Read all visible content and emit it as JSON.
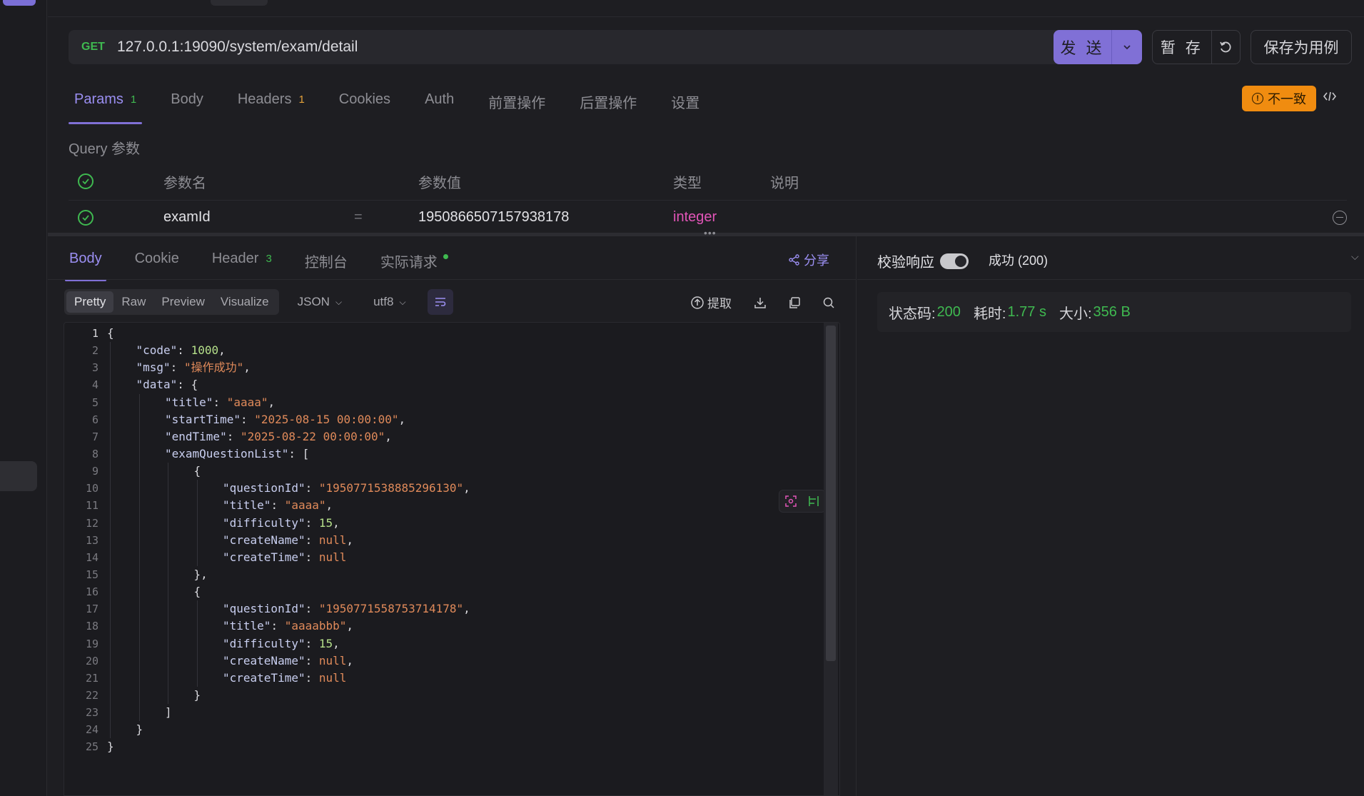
{
  "request": {
    "method": "GET",
    "url": "127.0.0.1:19090/system/exam/detail",
    "send_label": "发 送",
    "stash_label": "暂 存",
    "save_case_label": "保存为用例"
  },
  "req_tabs": [
    {
      "label": "Params",
      "badge": "1"
    },
    {
      "label": "Body",
      "badge": ""
    },
    {
      "label": "Headers",
      "badge": "1"
    },
    {
      "label": "Cookies",
      "badge": ""
    },
    {
      "label": "Auth",
      "badge": ""
    },
    {
      "label": "前置操作",
      "badge": ""
    },
    {
      "label": "后置操作",
      "badge": ""
    },
    {
      "label": "设置",
      "badge": ""
    }
  ],
  "mismatch_label": "不一致",
  "query": {
    "title": "Query 参数",
    "headers": {
      "name": "参数名",
      "value": "参数值",
      "type": "类型",
      "desc": "说明"
    },
    "row": {
      "name": "examId",
      "eq": "=",
      "value": "1950866507157938178",
      "type": "integer",
      "desc": ""
    }
  },
  "resp_tabs": [
    {
      "label": "Body",
      "badge": ""
    },
    {
      "label": "Cookie",
      "badge": ""
    },
    {
      "label": "Header",
      "badge": "3"
    },
    {
      "label": "控制台",
      "badge": ""
    },
    {
      "label": "实际请求",
      "badge": ""
    }
  ],
  "share_label": "分享",
  "format_buttons": [
    "Pretty",
    "Raw",
    "Preview",
    "Visualize"
  ],
  "format_select": "JSON",
  "encoding_select": "utf8",
  "extract_label": "提取",
  "validate_label": "校验响应",
  "success_label": "成功 (200)",
  "status": {
    "code_label": "状态码:",
    "code": "200",
    "time_label": "耗时:",
    "time": "1.77 s",
    "size_label": "大小:",
    "size": "356 B"
  },
  "code_lines": [
    [
      {
        "t": "p",
        "v": "{"
      }
    ],
    [
      {
        "t": "k",
        "v": "\"code\""
      },
      {
        "t": "p",
        "v": ": "
      },
      {
        "t": "n",
        "v": "1000"
      },
      {
        "t": "p",
        "v": ","
      }
    ],
    [
      {
        "t": "k",
        "v": "\"msg\""
      },
      {
        "t": "p",
        "v": ": "
      },
      {
        "t": "s",
        "v": "\"操作成功\""
      },
      {
        "t": "p",
        "v": ","
      }
    ],
    [
      {
        "t": "k",
        "v": "\"data\""
      },
      {
        "t": "p",
        "v": ": {"
      }
    ],
    [
      {
        "t": "k",
        "v": "\"title\""
      },
      {
        "t": "p",
        "v": ": "
      },
      {
        "t": "s",
        "v": "\"aaaa\""
      },
      {
        "t": "p",
        "v": ","
      }
    ],
    [
      {
        "t": "k",
        "v": "\"startTime\""
      },
      {
        "t": "p",
        "v": ": "
      },
      {
        "t": "s",
        "v": "\"2025-08-15 00:00:00\""
      },
      {
        "t": "p",
        "v": ","
      }
    ],
    [
      {
        "t": "k",
        "v": "\"endTime\""
      },
      {
        "t": "p",
        "v": ": "
      },
      {
        "t": "s",
        "v": "\"2025-08-22 00:00:00\""
      },
      {
        "t": "p",
        "v": ","
      }
    ],
    [
      {
        "t": "k",
        "v": "\"examQuestionList\""
      },
      {
        "t": "p",
        "v": ": ["
      }
    ],
    [
      {
        "t": "p",
        "v": "{"
      }
    ],
    [
      {
        "t": "k",
        "v": "\"questionId\""
      },
      {
        "t": "p",
        "v": ": "
      },
      {
        "t": "s",
        "v": "\"1950771538885296130\""
      },
      {
        "t": "p",
        "v": ","
      }
    ],
    [
      {
        "t": "k",
        "v": "\"title\""
      },
      {
        "t": "p",
        "v": ": "
      },
      {
        "t": "s",
        "v": "\"aaaa\""
      },
      {
        "t": "p",
        "v": ","
      }
    ],
    [
      {
        "t": "k",
        "v": "\"difficulty\""
      },
      {
        "t": "p",
        "v": ": "
      },
      {
        "t": "n",
        "v": "15"
      },
      {
        "t": "p",
        "v": ","
      }
    ],
    [
      {
        "t": "k",
        "v": "\"createName\""
      },
      {
        "t": "p",
        "v": ": "
      },
      {
        "t": "nl",
        "v": "null"
      },
      {
        "t": "p",
        "v": ","
      }
    ],
    [
      {
        "t": "k",
        "v": "\"createTime\""
      },
      {
        "t": "p",
        "v": ": "
      },
      {
        "t": "nl",
        "v": "null"
      }
    ],
    [
      {
        "t": "p",
        "v": "},"
      }
    ],
    [
      {
        "t": "p",
        "v": "{"
      }
    ],
    [
      {
        "t": "k",
        "v": "\"questionId\""
      },
      {
        "t": "p",
        "v": ": "
      },
      {
        "t": "s",
        "v": "\"1950771558753714178\""
      },
      {
        "t": "p",
        "v": ","
      }
    ],
    [
      {
        "t": "k",
        "v": "\"title\""
      },
      {
        "t": "p",
        "v": ": "
      },
      {
        "t": "s",
        "v": "\"aaaabbb\""
      },
      {
        "t": "p",
        "v": ","
      }
    ],
    [
      {
        "t": "k",
        "v": "\"difficulty\""
      },
      {
        "t": "p",
        "v": ": "
      },
      {
        "t": "n",
        "v": "15"
      },
      {
        "t": "p",
        "v": ","
      }
    ],
    [
      {
        "t": "k",
        "v": "\"createName\""
      },
      {
        "t": "p",
        "v": ": "
      },
      {
        "t": "nl",
        "v": "null"
      },
      {
        "t": "p",
        "v": ","
      }
    ],
    [
      {
        "t": "k",
        "v": "\"createTime\""
      },
      {
        "t": "p",
        "v": ": "
      },
      {
        "t": "nl",
        "v": "null"
      }
    ],
    [
      {
        "t": "p",
        "v": "}"
      }
    ],
    [
      {
        "t": "p",
        "v": "]"
      }
    ],
    [
      {
        "t": "p",
        "v": "}"
      }
    ],
    [
      {
        "t": "p",
        "v": "}"
      }
    ]
  ],
  "colors": {
    "accent": "#8070d6",
    "success": "#3fb950",
    "warning": "#f08c10",
    "type_pink": "#e255b8"
  }
}
